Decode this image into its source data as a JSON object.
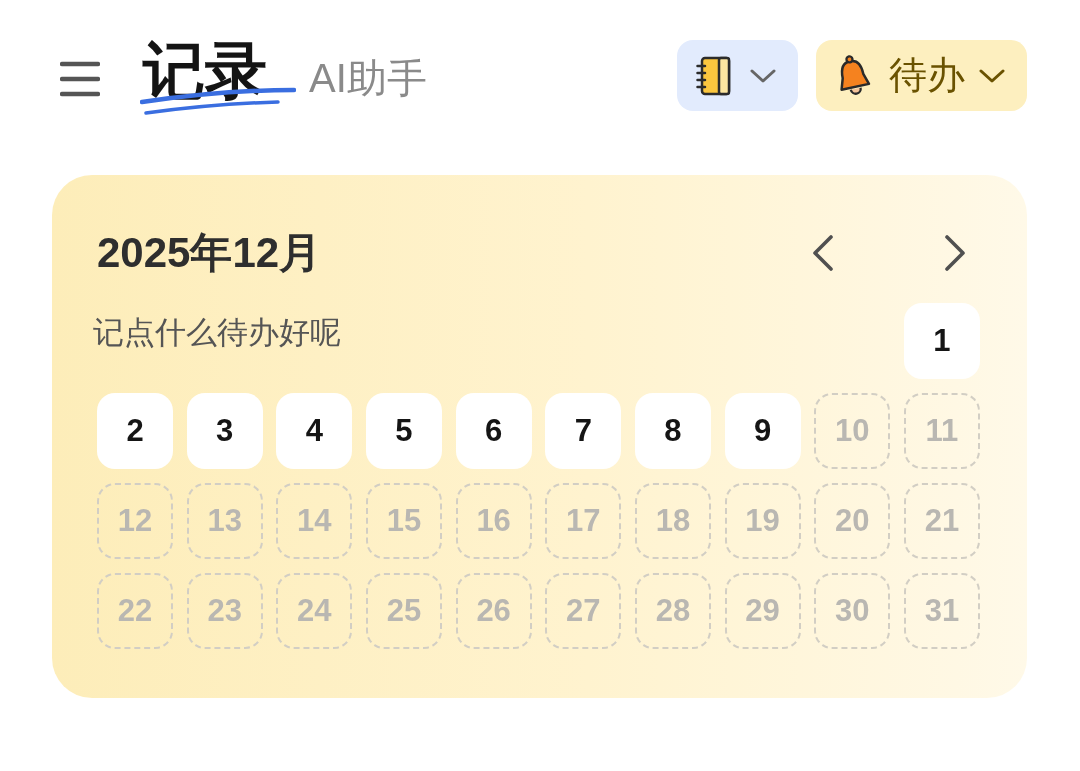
{
  "header": {
    "tabs": [
      {
        "label": "记录",
        "selected": true
      },
      {
        "label": "AI助手",
        "selected": false
      }
    ],
    "todo_menu": {
      "label": "待办"
    }
  },
  "calendar": {
    "title": "2025年12月",
    "prompt": "记点什么待办好呢",
    "days": [
      {
        "label": "1",
        "disabled": false
      },
      {
        "label": "2",
        "disabled": false
      },
      {
        "label": "3",
        "disabled": false
      },
      {
        "label": "4",
        "disabled": false
      },
      {
        "label": "5",
        "disabled": false
      },
      {
        "label": "6",
        "disabled": false
      },
      {
        "label": "7",
        "disabled": false
      },
      {
        "label": "8",
        "disabled": false
      },
      {
        "label": "9",
        "disabled": false
      },
      {
        "label": "10",
        "disabled": true
      },
      {
        "label": "11",
        "disabled": true
      },
      {
        "label": "12",
        "disabled": true
      },
      {
        "label": "13",
        "disabled": true
      },
      {
        "label": "14",
        "disabled": true
      },
      {
        "label": "15",
        "disabled": true
      },
      {
        "label": "16",
        "disabled": true
      },
      {
        "label": "17",
        "disabled": true
      },
      {
        "label": "18",
        "disabled": true
      },
      {
        "label": "19",
        "disabled": true
      },
      {
        "label": "20",
        "disabled": true
      },
      {
        "label": "21",
        "disabled": true
      },
      {
        "label": "22",
        "disabled": true
      },
      {
        "label": "23",
        "disabled": true
      },
      {
        "label": "24",
        "disabled": true
      },
      {
        "label": "25",
        "disabled": true
      },
      {
        "label": "26",
        "disabled": true
      },
      {
        "label": "27",
        "disabled": true
      },
      {
        "label": "28",
        "disabled": true
      },
      {
        "label": "29",
        "disabled": true
      },
      {
        "label": "30",
        "disabled": true
      },
      {
        "label": "31",
        "disabled": true
      }
    ]
  }
}
